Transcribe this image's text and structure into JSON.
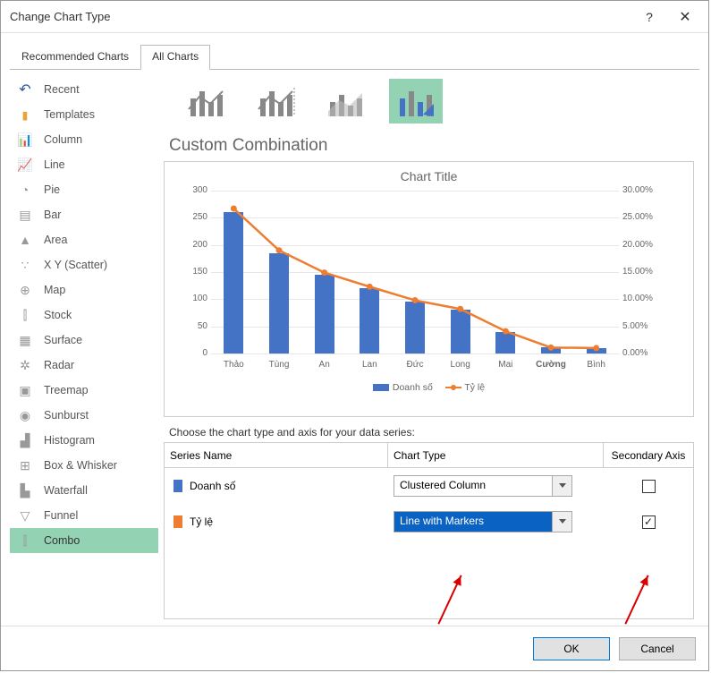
{
  "dialog": {
    "title": "Change Chart Type"
  },
  "tabs": {
    "recommended": "Recommended Charts",
    "all": "All Charts"
  },
  "sidebar": {
    "items": [
      {
        "label": "Recent",
        "icon": "recent"
      },
      {
        "label": "Templates",
        "icon": "folder"
      },
      {
        "label": "Column",
        "icon": "column"
      },
      {
        "label": "Line",
        "icon": "line"
      },
      {
        "label": "Pie",
        "icon": "pie"
      },
      {
        "label": "Bar",
        "icon": "bar"
      },
      {
        "label": "Area",
        "icon": "area"
      },
      {
        "label": "X Y (Scatter)",
        "icon": "scatter"
      },
      {
        "label": "Map",
        "icon": "map"
      },
      {
        "label": "Stock",
        "icon": "stock"
      },
      {
        "label": "Surface",
        "icon": "surface"
      },
      {
        "label": "Radar",
        "icon": "radar"
      },
      {
        "label": "Treemap",
        "icon": "treemap"
      },
      {
        "label": "Sunburst",
        "icon": "sunburst"
      },
      {
        "label": "Histogram",
        "icon": "histogram"
      },
      {
        "label": "Box & Whisker",
        "icon": "box"
      },
      {
        "label": "Waterfall",
        "icon": "waterfall"
      },
      {
        "label": "Funnel",
        "icon": "funnel"
      },
      {
        "label": "Combo",
        "icon": "combo"
      }
    ],
    "selected": 18
  },
  "heading": "Custom Combination",
  "instruction": "Choose the chart type and axis for your data series:",
  "grid": {
    "headers": {
      "name": "Series Name",
      "type": "Chart Type",
      "axis": "Secondary Axis"
    },
    "rows": [
      {
        "color": "#4472c4",
        "name": "Doanh số",
        "type": "Clustered Column",
        "secondary": false
      },
      {
        "color": "#ed7d31",
        "name": "Tỷ lệ",
        "type": "Line with Markers",
        "secondary": true,
        "selected": true
      }
    ]
  },
  "footer": {
    "ok": "OK",
    "cancel": "Cancel"
  },
  "chart_data": {
    "type": "combo",
    "title": "Chart Title",
    "categories": [
      "Thảo",
      "Tùng",
      "An",
      "Lan",
      "Đức",
      "Long",
      "Mai",
      "Cường",
      "Bình"
    ],
    "series": [
      {
        "name": "Doanh số",
        "type": "bar",
        "axis": "primary",
        "values": [
          260,
          185,
          145,
          120,
          95,
          80,
          40,
          11,
          10
        ]
      },
      {
        "name": "Tỷ lệ",
        "type": "line-marker",
        "axis": "secondary",
        "values": [
          0.267,
          0.19,
          0.149,
          0.123,
          0.098,
          0.082,
          0.041,
          0.011,
          0.01
        ]
      }
    ],
    "y_primary": {
      "min": 0,
      "max": 300,
      "ticks": [
        0,
        50,
        100,
        150,
        200,
        250,
        300
      ]
    },
    "y_secondary": {
      "min": 0,
      "max": 0.3,
      "ticks": [
        "0.00%",
        "5.00%",
        "10.00%",
        "15.00%",
        "20.00%",
        "25.00%",
        "30.00%"
      ]
    },
    "legend": [
      "Doanh số",
      "Tỷ lệ"
    ]
  }
}
